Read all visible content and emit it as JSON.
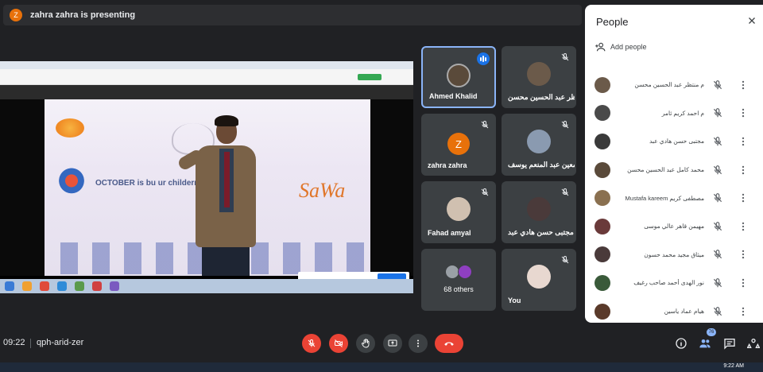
{
  "presenter": {
    "initial": "Z",
    "text": "zahra zahra is presenting"
  },
  "screen": {
    "banner_text": "OCTOBER is bu          ur childern",
    "brand": "SaWa"
  },
  "tiles": [
    {
      "name": "Ahmed Khalid",
      "active": true,
      "speaking": true
    },
    {
      "name": "منتظر عبد الحسين محسن..."
    },
    {
      "name": "zahra zahra",
      "initial": "Z"
    },
    {
      "name": "معين عبد المنعم يوسف..."
    },
    {
      "name": "Fahad amyal"
    },
    {
      "name": "مجتبى حسن هادي عبد"
    },
    {
      "name": "68 others"
    },
    {
      "name": "You"
    }
  ],
  "people": {
    "title": "People",
    "add_people": "Add people",
    "members": [
      {
        "name": "م منتظر عبد الحسين محسن",
        "color": "#6b5a4a"
      },
      {
        "name": "م احمد كريم ثامر",
        "color": "#4a4a4a"
      },
      {
        "name": "مجتبى حسن هادي عبد",
        "color": "#3a3a3a"
      },
      {
        "name": "محمد كامل عبد الحسين محسن",
        "color": "#5a4a3a"
      },
      {
        "name": "Mustafa kareem مصطفى كريم",
        "color": "#8a7050"
      },
      {
        "name": "مهيمن قاهر عالي موسى",
        "color": "#6a3a3a"
      },
      {
        "name": "ميثاق مجيد محمد حسون",
        "color": "#4a3a3a"
      },
      {
        "name": "نور الهدى أحمد صاحب رغيف",
        "color": "#3a5a3a"
      },
      {
        "name": "هيام عماد ياسين",
        "color": "#5a3a2a"
      }
    ]
  },
  "bottom": {
    "time": "09:22",
    "meeting_code": "qph-arid-zer",
    "participants_badge": "76"
  },
  "taskbar": {
    "clock": "9:22 AM"
  }
}
